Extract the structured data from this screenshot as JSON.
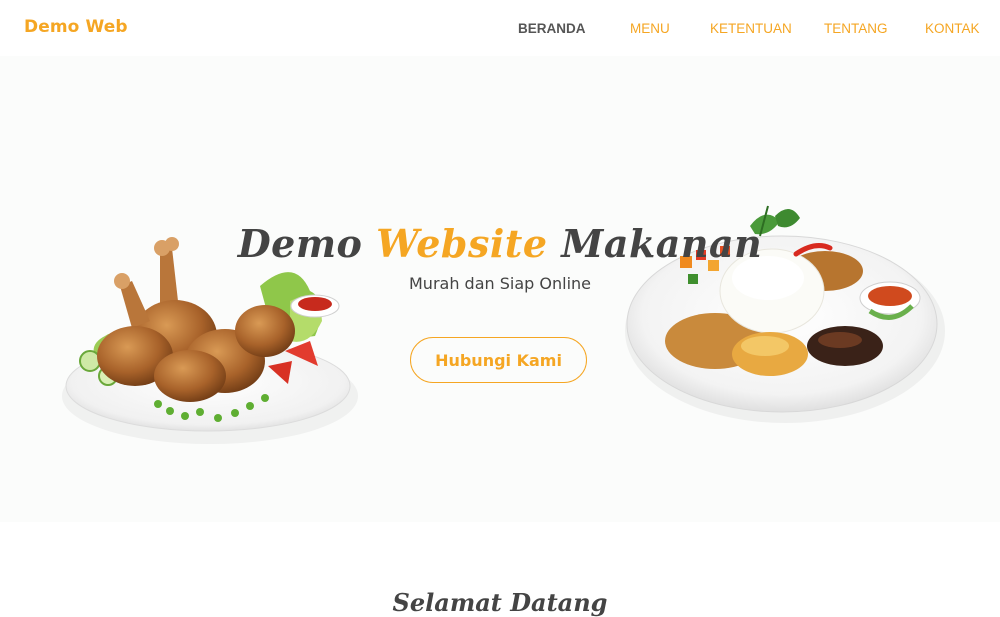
{
  "navbar": {
    "brand": "Demo Web",
    "links": [
      {
        "label": "BERANDA",
        "active": true
      },
      {
        "label": "MENU",
        "active": false
      },
      {
        "label": "KETENTUAN",
        "active": false
      },
      {
        "label": "TENTANG",
        "active": false
      },
      {
        "label": "KONTAK",
        "active": false
      }
    ]
  },
  "hero": {
    "title_part1": "Demo ",
    "title_accent": "Website",
    "title_part2": " Makanan",
    "subtitle": "Murah dan Siap Online",
    "cta_label": "Hubungi Kami",
    "images": {
      "left": "grilled-chicken-plate",
      "right": "rice-plate-with-sides"
    }
  },
  "welcome": {
    "heading": "Selamat Datang"
  },
  "colors": {
    "accent": "#f5a623",
    "text_dark": "#444444",
    "nav_active": "#555555",
    "hero_bg": "#fbfcfb"
  }
}
